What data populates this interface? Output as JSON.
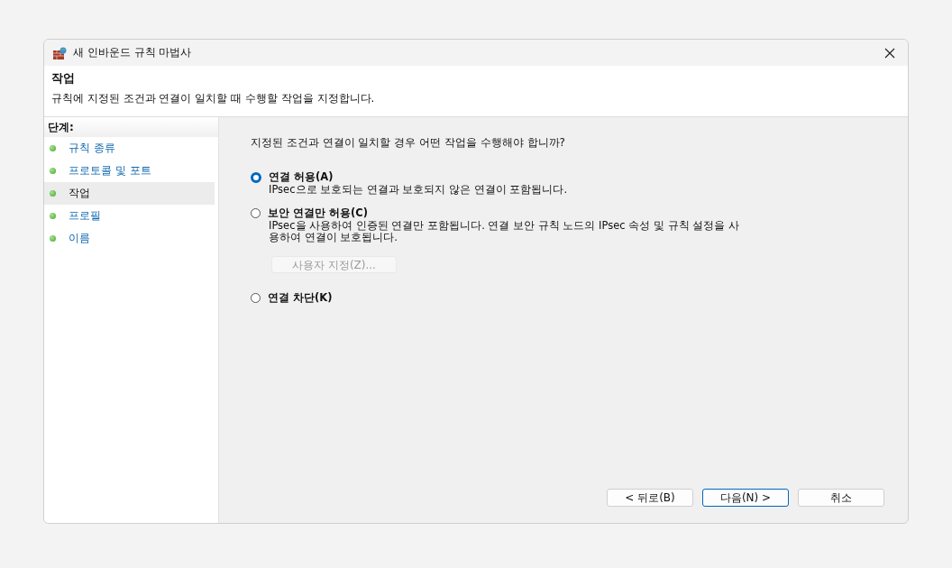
{
  "window": {
    "title": "새 인바운드 규칙 마법사"
  },
  "header": {
    "title": "작업",
    "description": "규칙에 지정된 조건과 연결이 일치할 때 수행할 작업을 지정합니다."
  },
  "sidebar": {
    "heading": "단계:",
    "items": [
      {
        "label": "규칙 종류",
        "selected": false
      },
      {
        "label": "프로토콜 및 포트",
        "selected": false
      },
      {
        "label": "작업",
        "selected": true
      },
      {
        "label": "프로필",
        "selected": false
      },
      {
        "label": "이름",
        "selected": false
      }
    ]
  },
  "question": "지정된 조건과 연결이 일치할 경우 어떤 작업을 수행해야 합니까?",
  "options": [
    {
      "label": "연결 허용(A)",
      "selected": true,
      "description": "IPsec으로 보호되는 연결과 보호되지 않은 연결이 포함됩니다."
    },
    {
      "label": "보안 연결만 허용(C)",
      "selected": false,
      "description": "IPsec을 사용하여 인증된 연결만 포함됩니다. 연결 보안 규칙 노드의 IPsec 속성 및 규칙 설정을 사용하여 연결이 보호됩니다.",
      "button": {
        "label": "사용자 지정(Z)...",
        "disabled": true
      }
    },
    {
      "label": "연결 차단(K)",
      "selected": false
    }
  ],
  "buttons": [
    {
      "label": "< 뒤로(B)",
      "default": false
    },
    {
      "label": "다음(N) >",
      "default": true
    },
    {
      "label": "취소",
      "default": false
    }
  ]
}
